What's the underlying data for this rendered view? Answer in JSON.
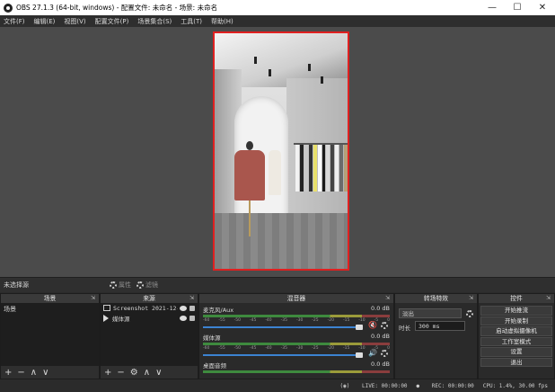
{
  "window": {
    "title": "OBS 27.1.3 (64-bit, windows) - 配置文件: 未命名 - 场景: 未命名",
    "minimize": "—",
    "maximize": "☐",
    "close": "✕"
  },
  "menu": [
    "文件(F)",
    "编辑(E)",
    "视图(V)",
    "配置文件(P)",
    "场景集合(S)",
    "工具(T)",
    "帮助(H)"
  ],
  "scene_strip": {
    "no_scene": "未选择源",
    "properties": "属性",
    "filters": "滤镜"
  },
  "docks": {
    "scenes": {
      "title": "场景",
      "items": [
        "场景"
      ],
      "foot": [
        "+",
        "−",
        "∧",
        "∨"
      ]
    },
    "sources": {
      "title": "来源",
      "items": [
        {
          "name": "Screenshot 2021-12-",
          "icon": "screenshot-icon"
        },
        {
          "name": "媒体源",
          "icon": "play-icon"
        }
      ],
      "foot": [
        "+",
        "−",
        "⚙",
        "∧",
        "∨"
      ]
    },
    "mixer": {
      "title": "混音器",
      "channels": [
        {
          "name": "麦克风/Aux",
          "level": "0.0 dB",
          "muted": true
        },
        {
          "name": "媒体源",
          "level": "0.0 dB",
          "muted": false
        },
        {
          "name": "桌面音频",
          "level": "0.0 dB",
          "muted": false
        }
      ],
      "ticks": [
        "-60",
        "-55",
        "-50",
        "-45",
        "-40",
        "-35",
        "-30",
        "-25",
        "-20",
        "-15",
        "-10",
        "-5",
        "0"
      ]
    },
    "transitions": {
      "title": "转场特效",
      "selected": "淡出",
      "duration_label": "时长",
      "duration_value": "300 ms"
    },
    "controls": {
      "title": "控件",
      "buttons": [
        "开始推流",
        "开始录制",
        "启动虚拟摄像机",
        "工作室模式",
        "设置",
        "退出"
      ]
    }
  },
  "status": {
    "live": "LIVE: 00:00:00",
    "rec": "REC: 00:00:00",
    "cpu": "CPU: 1.4%, 30.00 fps"
  },
  "colors": {
    "accent": "#3c83d1",
    "preview_border": "#e02020",
    "mute_red": "#e02020"
  }
}
